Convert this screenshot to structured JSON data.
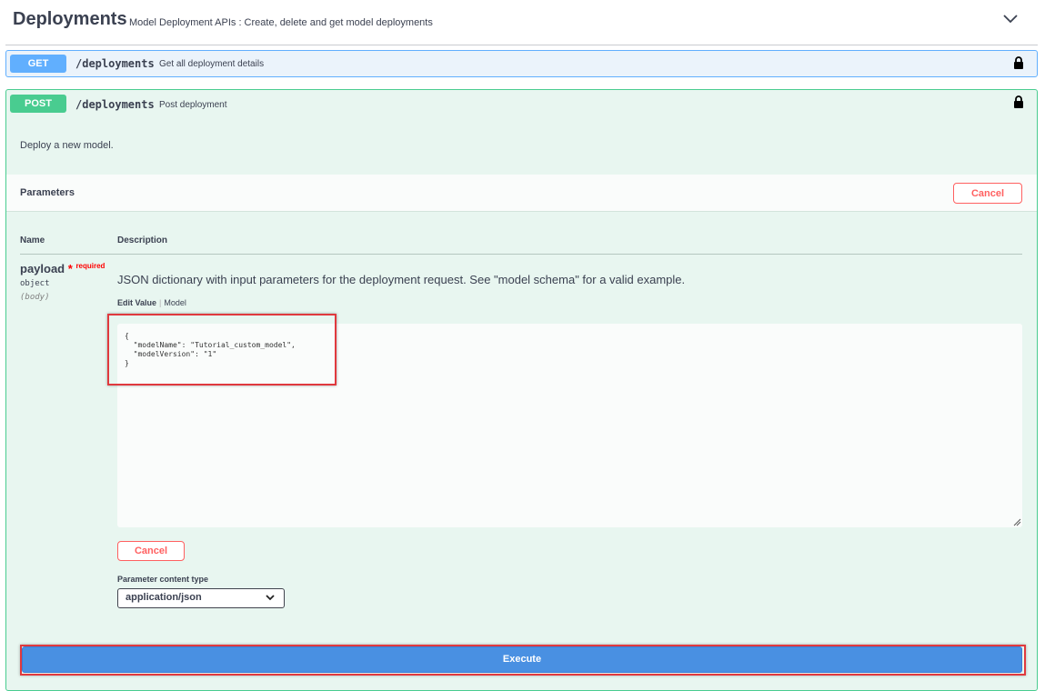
{
  "tag": {
    "title": "Deployments",
    "description": "Model Deployment APIs : Create, delete and get model deployments"
  },
  "operations": {
    "get": {
      "method": "GET",
      "path": "/deployments",
      "summary": "Get all deployment details"
    },
    "post": {
      "method": "POST",
      "path": "/deployments",
      "summary": "Post deployment",
      "description": "Deploy a new model.",
      "parameters_title": "Parameters",
      "cancel_label": "Cancel",
      "columns": {
        "name": "Name",
        "description": "Description"
      },
      "param": {
        "name": "payload",
        "required_star": "*",
        "required_label": "required",
        "type": "object",
        "in": "(body)",
        "description": "JSON dictionary with input parameters for the deployment request. See \"model schema\" for a valid example."
      },
      "tabs": {
        "edit_value": "Edit Value",
        "model": "Model"
      },
      "body_value": "{\n  \"modelName\": \"Tutorial_custom_model\",\n  \"modelVersion\": \"1\"\n}",
      "content_type_label": "Parameter content type",
      "content_type_value": "application/json",
      "execute_label": "Execute"
    }
  },
  "colors": {
    "get": "#61affe",
    "post": "#49cc90",
    "cancel": "#ff6060",
    "execute": "#4990e2",
    "highlight": "#e0393e"
  },
  "icons": {
    "collapse": "chevron-down-icon",
    "auth": "lock-icon",
    "resize": "resize-grip-icon"
  }
}
